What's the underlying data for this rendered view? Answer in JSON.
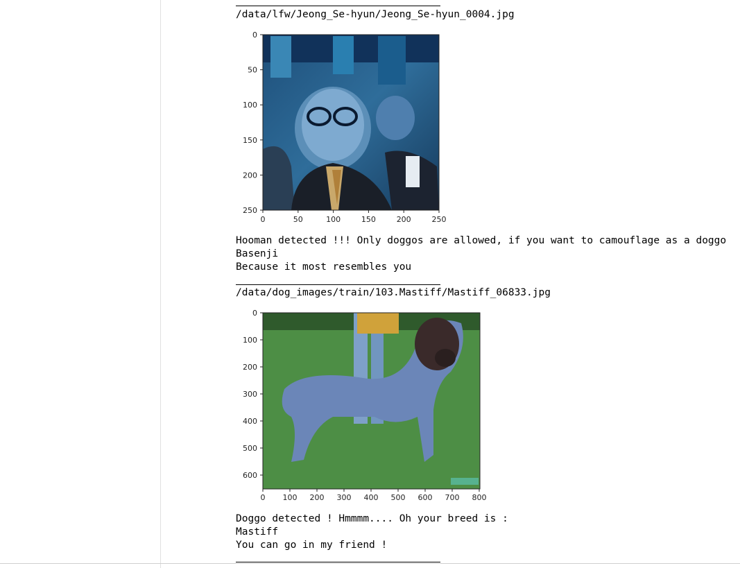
{
  "separator_top": "________________________________________",
  "block1": {
    "path": "/data/lfw/Jeong_Se-hyun/Jeong_Se-hyun_0004.jpg",
    "plot": {
      "y_ticks": [
        "0",
        "50",
        "100",
        "150",
        "200",
        "250"
      ],
      "x_ticks": [
        "0",
        "50",
        "100",
        "150",
        "200",
        "250"
      ],
      "image": "blue-tinted photo of a man in glasses and suit"
    },
    "lines": [
      "Hooman detected !!! Only doggos are allowed, if you want to camouflage as a doggo",
      "Basenji",
      "Because it most resembles you"
    ]
  },
  "separator_mid": "________________________________________",
  "block2": {
    "path": "/data/dog_images/train/103.Mastiff/Mastiff_06833.jpg",
    "plot": {
      "y_ticks": [
        "0",
        "100",
        "200",
        "300",
        "400",
        "500",
        "600"
      ],
      "x_ticks": [
        "0",
        "100",
        "200",
        "300",
        "400",
        "500",
        "600",
        "700",
        "800"
      ],
      "image": "bluish mastiff dog standing on grass"
    },
    "lines": [
      "Doggo detected ! Hmmmm.... Oh your breed is :",
      "Mastiff",
      "You can go in my friend !"
    ]
  },
  "separator_bottom": "________________________________________"
}
